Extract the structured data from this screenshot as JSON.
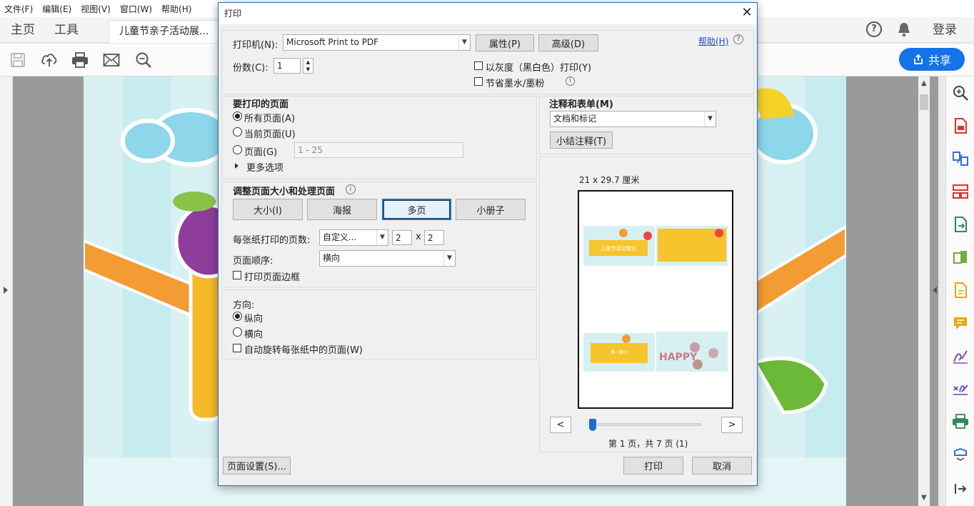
{
  "app": {
    "menu": [
      "文件(F)",
      "编辑(E)",
      "视图(V)",
      "窗口(W)",
      "帮助(H)"
    ],
    "tabs": {
      "home": "主页",
      "tools": "工具",
      "doc": "儿童节亲子活动展..."
    },
    "login": "登录",
    "share": "共享"
  },
  "dialog": {
    "title": "打印",
    "printer_label": "打印机(N):",
    "printer_value": "Microsoft Print to PDF",
    "properties": "属性(P)",
    "advanced": "高级(D)",
    "help": "帮助(H)",
    "copies_label": "份数(C):",
    "copies_value": "1",
    "grayscale": "以灰度（黑白色）打印(Y)",
    "save_ink": "节省墨水/墨粉",
    "pages_header": "要打印的页面",
    "all_pages": "所有页面(A)",
    "current_page": "当前页面(U)",
    "pages": "页面(G)",
    "pages_placeholder": "1 - 25",
    "more_options": "更多选项",
    "size_header": "调整页面大小和处理页面",
    "size_btn": "大小(I)",
    "poster_btn": "海报",
    "multiple_btn": "多页",
    "booklet_btn": "小册子",
    "pps_label": "每张纸打印的页数:",
    "pps_value": "自定义...",
    "pps_x": "2",
    "pps_times": "x",
    "pps_y": "2",
    "order_label": "页面顺序:",
    "order_value": "横向",
    "print_border": "打印页面边框",
    "orientation_label": "方向:",
    "portrait": "纵向",
    "landscape": "横向",
    "auto_rotate": "自动旋转每张纸中的页面(W)",
    "comments_header": "注释和表单(M)",
    "comments_value": "文档和标记",
    "summarize": "小结注释(T)",
    "paper_size": "21 x 29.7 厘米",
    "prev": "<",
    "next": ">",
    "page_status": "第 1 页，共 7 页 (1)",
    "preview_text": {
      "title": "儿童节活动策划",
      "part": "第一部分",
      "happy": "HAPPY"
    },
    "page_setup": "页面设置(S)...",
    "print": "打印",
    "cancel": "取消"
  }
}
